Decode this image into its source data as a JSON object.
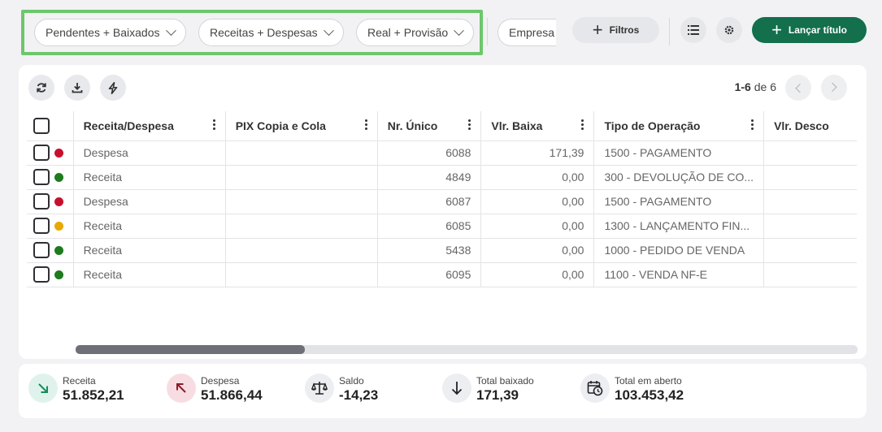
{
  "filters": {
    "status": "Pendentes + Baixados",
    "type": "Receitas + Despesas",
    "mode": "Real + Provisão",
    "company_placeholder": "Empresa"
  },
  "actions": {
    "filtros_label": "Filtros",
    "lancar_label": "Lançar título"
  },
  "pagination": {
    "range": "1-6",
    "of_label": "de",
    "total": "6"
  },
  "table": {
    "columns": [
      "Receita/Despesa",
      "PIX Copia e Cola",
      "Nr. Único",
      "Vlr. Baixa",
      "Tipo de Operação",
      "Vlr. Desco"
    ],
    "rows": [
      {
        "status_color": "#c8102e",
        "tipo": "Despesa",
        "pix": "",
        "nr": "6088",
        "vlr_baixa": "171,39",
        "operacao": "1500 - PAGAMENTO",
        "desc": ""
      },
      {
        "status_color": "#1e7b1e",
        "tipo": "Receita",
        "pix": "",
        "nr": "4849",
        "vlr_baixa": "0,00",
        "operacao": "300 - DEVOLUÇÃO DE CO...",
        "desc": ""
      },
      {
        "status_color": "#c8102e",
        "tipo": "Despesa",
        "pix": "",
        "nr": "6087",
        "vlr_baixa": "0,00",
        "operacao": "1500 - PAGAMENTO",
        "desc": ""
      },
      {
        "status_color": "#e8a800",
        "tipo": "Receita",
        "pix": "",
        "nr": "6085",
        "vlr_baixa": "0,00",
        "operacao": "1300 - LANÇAMENTO FIN...",
        "desc": ""
      },
      {
        "status_color": "#1e7b1e",
        "tipo": "Receita",
        "pix": "",
        "nr": "5438",
        "vlr_baixa": "0,00",
        "operacao": "1000 - PEDIDO DE VENDA",
        "desc": ""
      },
      {
        "status_color": "#1e7b1e",
        "tipo": "Receita",
        "pix": "",
        "nr": "6095",
        "vlr_baixa": "0,00",
        "operacao": "1100 - VENDA NF-E",
        "desc": ""
      }
    ]
  },
  "summary": [
    {
      "icon": "arrow-down-right-icon",
      "label": "Receita",
      "value": "51.852,21",
      "bg": "#dff3ec",
      "fg": "#1a8a5c"
    },
    {
      "icon": "arrow-up-left-icon",
      "label": "Despesa",
      "value": "51.866,44",
      "bg": "#f7dde2",
      "fg": "#8a1b2a"
    },
    {
      "icon": "scale-icon",
      "label": "Saldo",
      "value": "-14,23",
      "bg": "#eceef1",
      "fg": "#222"
    },
    {
      "icon": "arrow-down-icon",
      "label": "Total baixado",
      "value": "171,39",
      "bg": "#eceef1",
      "fg": "#222"
    },
    {
      "icon": "calendar-clock-icon",
      "label": "Total em aberto",
      "value": "103.453,42",
      "bg": "#eceef1",
      "fg": "#222"
    }
  ],
  "colors": {
    "accent": "#136f4c",
    "highlight": "#6cc76b"
  }
}
